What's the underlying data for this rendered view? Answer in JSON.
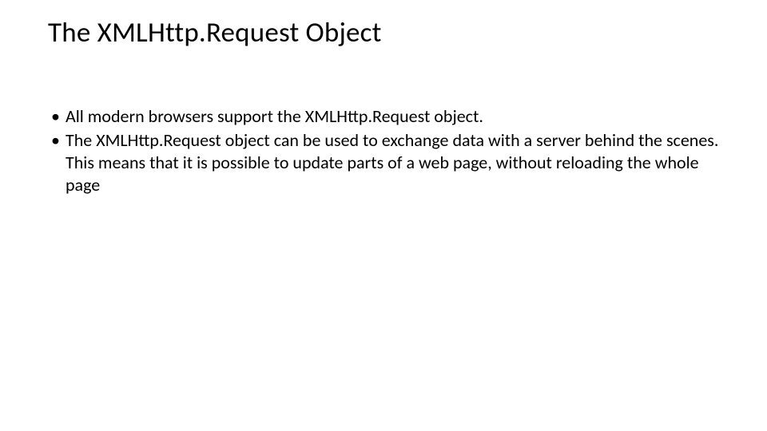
{
  "slide": {
    "title": "The XMLHttp.Request Object",
    "bullets": [
      "All modern browsers support the XMLHttp.Request object.",
      "The XMLHttp.Request object can be used to exchange data with a server behind the scenes. This means that it is possible to update parts of a web page, without reloading the whole page"
    ]
  }
}
